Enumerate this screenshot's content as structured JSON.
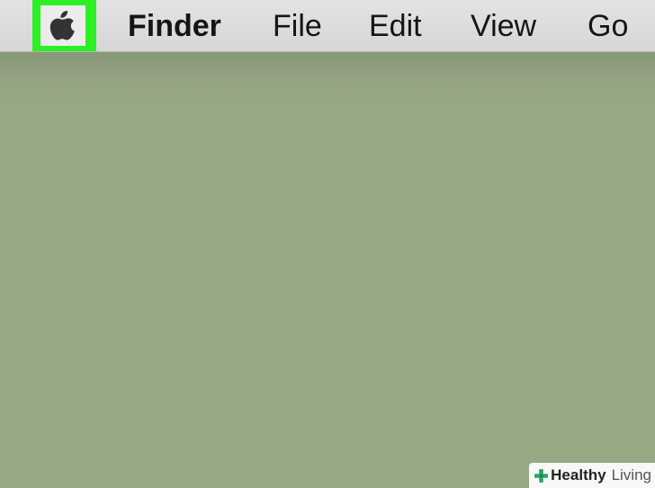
{
  "menubar": {
    "apple_icon": "apple-icon",
    "items": [
      "Finder",
      "File",
      "Edit",
      "View",
      "Go"
    ]
  },
  "colors": {
    "desktop": "#97a885",
    "menubar": "#dcdcdc",
    "highlight": "#2cf024",
    "watermark_accent": "#2aa56a"
  },
  "watermark": {
    "icon": "plus-icon",
    "text_bold": "Healthy",
    "text_regular": "Living"
  }
}
